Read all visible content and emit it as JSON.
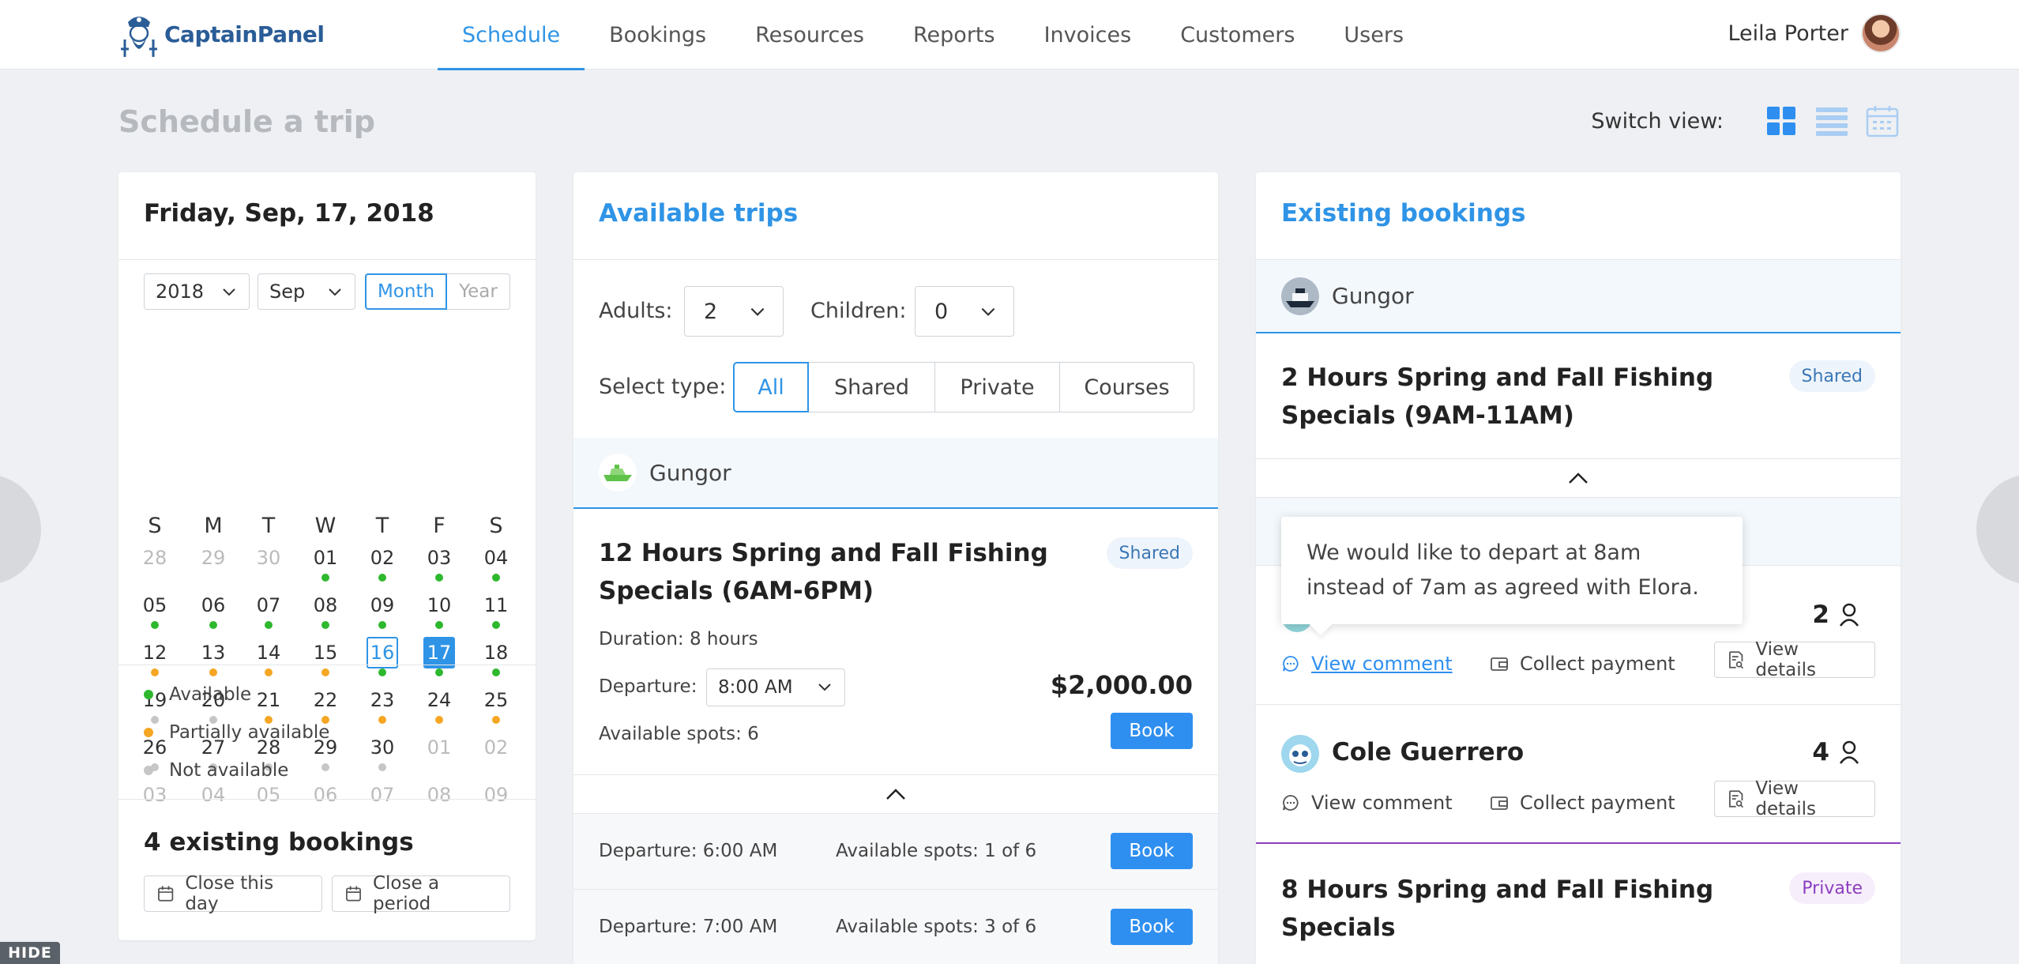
{
  "app": {
    "name": "CaptainPanel"
  },
  "nav": [
    {
      "label": "Schedule",
      "active": true
    },
    {
      "label": "Bookings"
    },
    {
      "label": "Resources"
    },
    {
      "label": "Reports"
    },
    {
      "label": "Invoices"
    },
    {
      "label": "Customers"
    },
    {
      "label": "Users"
    }
  ],
  "user": {
    "name": "Leila Porter"
  },
  "page": {
    "title": "Schedule a trip",
    "switch_view_label": "Switch view:"
  },
  "calendar": {
    "date_title": "Friday, Sep, 17, 2018",
    "year": "2018",
    "month": "Sep",
    "mode_month": "Month",
    "mode_year": "Year",
    "weekdays": [
      "S",
      "M",
      "T",
      "W",
      "T",
      "F",
      "S"
    ],
    "weeks": [
      [
        "28",
        "29",
        "30",
        "01",
        "02",
        "03",
        "04"
      ],
      [
        "05",
        "06",
        "07",
        "08",
        "09",
        "10",
        "11"
      ],
      [
        "12",
        "13",
        "14",
        "15",
        "16",
        "17",
        "18"
      ],
      [
        "19",
        "20",
        "21",
        "22",
        "23",
        "24",
        "25"
      ],
      [
        "26",
        "27",
        "28",
        "29",
        "30",
        "01",
        "02"
      ],
      [
        "03",
        "04",
        "05",
        "06",
        "07",
        "08",
        "09"
      ]
    ],
    "today": "16",
    "selected": "17",
    "legend": [
      "Available",
      "Partially available",
      "Not available"
    ],
    "existing_bookings": "4 existing bookings",
    "close_day": "Close this day",
    "close_period": "Close a period"
  },
  "colors": {
    "accent": "#2f94e6",
    "available": "#2eb82e",
    "partial": "#f5a623",
    "unavailable": "#c6c6c6"
  },
  "trips": {
    "title": "Available trips",
    "adults_label": "Adults:",
    "adults_value": "2",
    "children_label": "Children:",
    "children_value": "0",
    "select_type_label": "Select type:",
    "types": [
      "All",
      "Shared",
      "Private",
      "Courses"
    ],
    "operator": "Gungor",
    "trip_title_line1": "12 Hours Spring and Fall Fishing",
    "trip_title_line2": "Specials (6AM-6PM)",
    "tag": "Shared",
    "duration": "Duration: 8 hours",
    "departure_label": "Departure:",
    "departure_value": "8:00 AM",
    "price": "$2,000.00",
    "spots": "Available spots: 6",
    "book": "Book",
    "departures": [
      {
        "time": "Departure: 6:00 AM",
        "spots": "Available spots: 1 of 6"
      },
      {
        "time": "Departure: 7:00 AM",
        "spots": "Available spots: 3 of 6"
      }
    ]
  },
  "bookings": {
    "title": "Existing bookings",
    "operator": "Gungor",
    "trip1_line1": "2 Hours Spring and Fall Fishing",
    "trip1_line2": "Specials (9AM-11AM)",
    "trip1_tag": "Shared",
    "tooltip": "We would like to depart at 8am instead of 7am as agreed with Elora.",
    "row1_count": "2",
    "view_comment": "View comment",
    "collect_payment": "Collect payment",
    "view_details": "View details",
    "row2_name": "Cole Guerrero",
    "row2_count": "4",
    "trip2_line1": "8 Hours Spring and Fall Fishing",
    "trip2_line2": "Specials",
    "trip2_tag": "Private"
  },
  "hide_label": "HIDE"
}
